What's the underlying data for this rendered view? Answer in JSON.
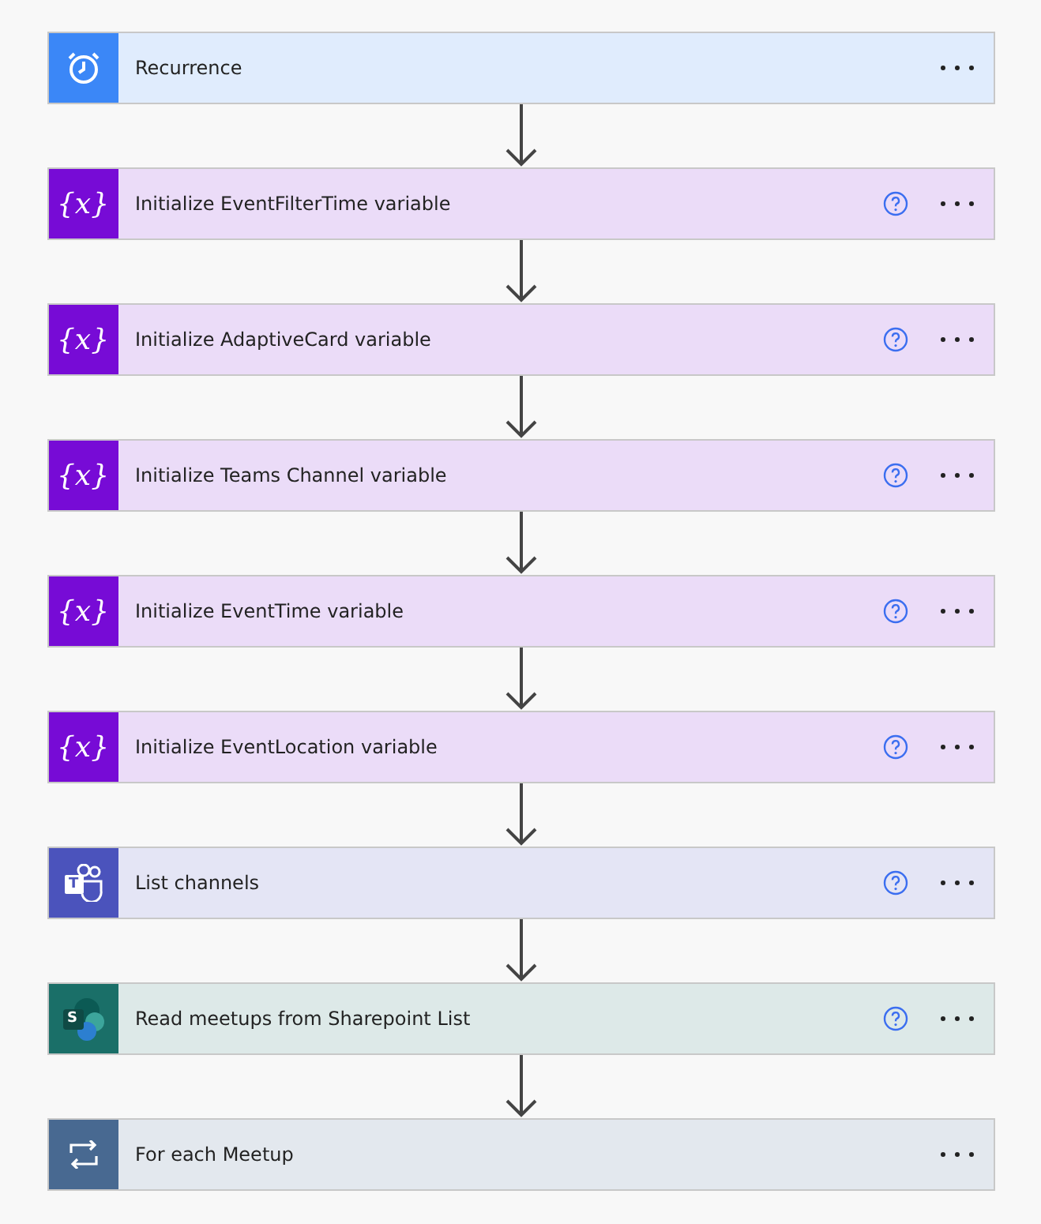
{
  "steps": [
    {
      "kind": "recurrence",
      "title": "Recurrence",
      "help": false
    },
    {
      "kind": "variable",
      "icon_text": "{x}",
      "title": "Initialize EventFilterTime variable",
      "help": true
    },
    {
      "kind": "variable",
      "icon_text": "{x}",
      "title": "Initialize AdaptiveCard variable",
      "help": true
    },
    {
      "kind": "variable",
      "icon_text": "{x}",
      "title": "Initialize Teams Channel variable",
      "help": true
    },
    {
      "kind": "variable",
      "icon_text": "{x}",
      "title": "Initialize EventTime variable",
      "help": true
    },
    {
      "kind": "variable",
      "icon_text": "{x}",
      "title": "Initialize EventLocation variable",
      "help": true
    },
    {
      "kind": "teams",
      "icon_text": "T",
      "title": "List channels",
      "help": true
    },
    {
      "kind": "sharepoint",
      "icon_text": "S",
      "title": "Read meetups from Sharepoint List",
      "help": true
    },
    {
      "kind": "foreach",
      "title": "For each Meetup",
      "help": false
    }
  ]
}
